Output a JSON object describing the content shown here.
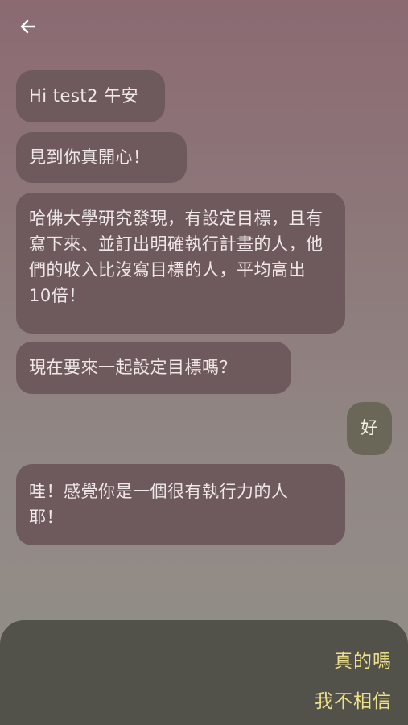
{
  "header": {
    "back_icon": "arrow-left-icon"
  },
  "messages": [
    {
      "sender": "bot",
      "text": "Hi test2 午安"
    },
    {
      "sender": "bot",
      "text": "見到你真開心！"
    },
    {
      "sender": "bot",
      "text": "哈佛大學研究發現，有設定目標，且有寫下來、並訂出明確執行計畫的人，他們的收入比沒寫目標的人，平均高出10倍！"
    },
    {
      "sender": "bot",
      "text": "現在要來一起設定目標嗎？"
    },
    {
      "sender": "user",
      "text": "好"
    },
    {
      "sender": "bot",
      "text": "哇！感覺你是一個很有執行力的人耶！"
    }
  ],
  "quick_replies": [
    {
      "label": "真的嗎"
    },
    {
      "label": "我不相信"
    }
  ],
  "colors": {
    "bot_bubble": "#6e5a5d",
    "user_bubble": "#6a6658",
    "reply_text": "#ede08a",
    "panel": "#52514a"
  }
}
